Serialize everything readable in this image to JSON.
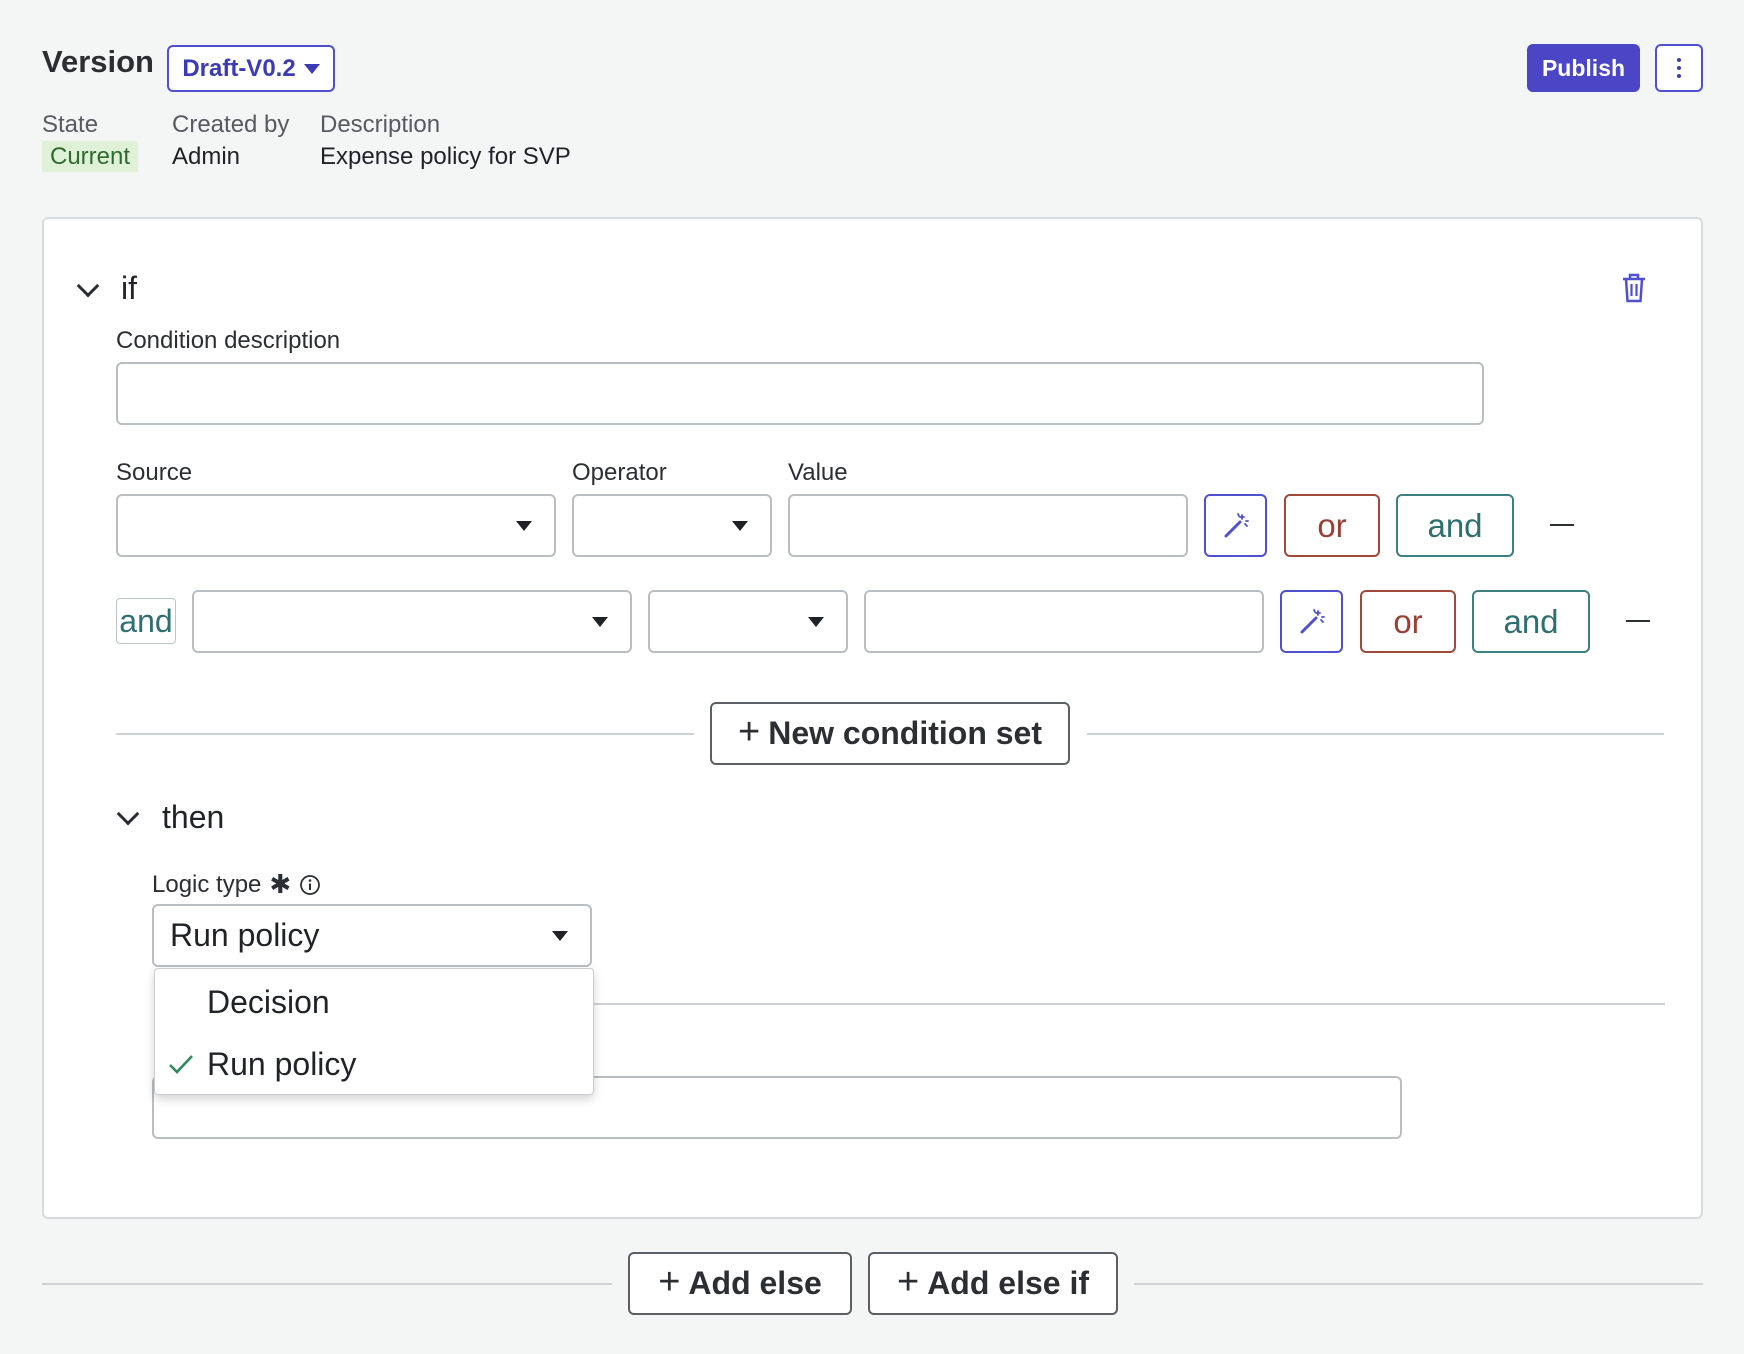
{
  "header": {
    "version_label": "Version",
    "version_value": "Draft-V0.2",
    "publish_label": "Publish",
    "more_icon": "more-vertical-icon"
  },
  "meta": {
    "state_label": "State",
    "state_value": "Current",
    "created_by_label": "Created by",
    "created_by_value": "Admin",
    "description_label": "Description",
    "description_value": "Expense policy for SVP"
  },
  "if_section": {
    "title": "if",
    "condition_description_label": "Condition description",
    "condition_description_value": "",
    "source_label": "Source",
    "operator_label": "Operator",
    "value_label": "Value",
    "rows": [
      {
        "connector": "",
        "source": "",
        "operator": "",
        "value": "",
        "or_label": "or",
        "and_label": "and"
      },
      {
        "connector": "and",
        "source": "",
        "operator": "",
        "value": "",
        "or_label": "or",
        "and_label": "and"
      }
    ],
    "new_condition_set_label": "New condition set"
  },
  "then_section": {
    "title": "then",
    "logic_type_label": "Logic type",
    "logic_type_value": "Run policy",
    "options": [
      {
        "label": "Decision",
        "selected": false
      },
      {
        "label": "Run policy",
        "selected": true
      }
    ]
  },
  "footer": {
    "add_else_label": "Add else",
    "add_else_if_label": "Add else if"
  },
  "colors": {
    "accent": "#4a46c6",
    "or": "#9a3f33",
    "and": "#2e6f70",
    "state_badge_bg": "#dff2d8"
  }
}
